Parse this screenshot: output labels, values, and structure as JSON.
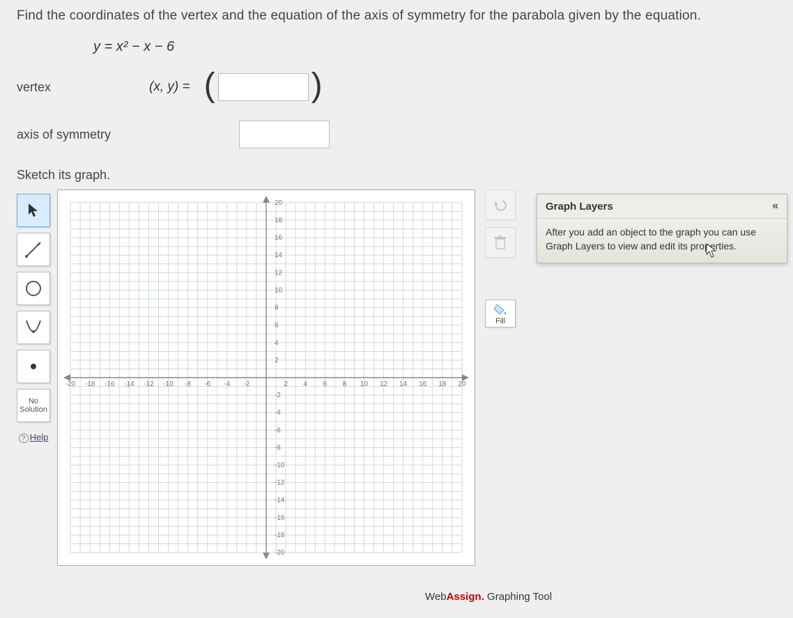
{
  "question": "Find the coordinates of the vertex and the equation of the axis of symmetry for the parabola given by the equation.",
  "equation": "y = x² − x − 6",
  "vertex_label": "vertex",
  "xy_prefix": "(x, y)  =",
  "axis_label": "axis of symmetry",
  "sketch_label": "Sketch its graph.",
  "toolbar": {
    "pointer": "pointer-tool",
    "line": "line-tool",
    "circle": "circle-tool",
    "parabola": "parabola-tool",
    "point": "point-tool",
    "nosolution_line1": "No",
    "nosolution_line2": "Solution",
    "help": "Help"
  },
  "fill_label": "Fill",
  "layers": {
    "title": "Graph Layers",
    "body": "After you add an object to the graph you can use Graph Layers to view and edit its properties."
  },
  "footer": {
    "brand1": "Web",
    "brand2": "Assign.",
    "tool": " Graphing Tool"
  },
  "chart_data": {
    "type": "scatter",
    "title": "",
    "xlabel": "",
    "ylabel": "",
    "xlim": [
      -20,
      20
    ],
    "ylim": [
      -20,
      20
    ],
    "xticks": [
      -20,
      -18,
      -16,
      -14,
      -12,
      -10,
      -8,
      -6,
      -4,
      -2,
      2,
      4,
      6,
      8,
      10,
      12,
      14,
      16,
      18,
      20
    ],
    "yticks": [
      -20,
      -18,
      -16,
      -14,
      -12,
      -10,
      -8,
      -6,
      -4,
      -2,
      2,
      4,
      6,
      8,
      10,
      12,
      14,
      16,
      18,
      20
    ],
    "series": []
  }
}
